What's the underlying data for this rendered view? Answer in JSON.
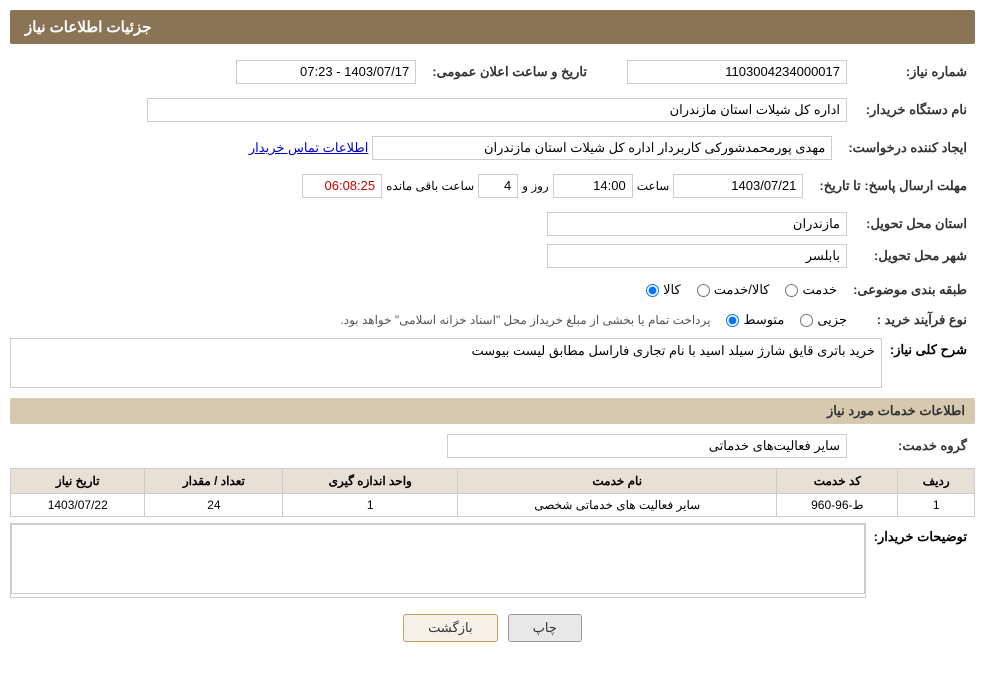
{
  "header": {
    "title": "جزئیات اطلاعات نیاز"
  },
  "fields": {
    "shomara_niaz_label": "شماره نیاز:",
    "shomara_niaz_value": "1103004234000017",
    "nam_dastgah_label": "نام دستگاه خریدار:",
    "nam_dastgah_value": "اداره کل شیلات استان مازندران",
    "ejad_konande_label": "ایجاد کننده درخواست:",
    "ejad_konande_value": "مهدی پورمحمدشورکی کاربردار اداره کل شیلات استان مازندران",
    "ejad_konande_link": "اطلاعات تماس خریدار",
    "mohlat_label": "مهلت ارسال پاسخ: تا تاریخ:",
    "mohlat_date": "1403/07/21",
    "mohlat_saat_label": "ساعت",
    "mohlat_saat": "14:00",
    "mohlat_roz_label": "روز و",
    "mohlat_roz": "4",
    "mohlat_baqi_label": "ساعت باقی مانده",
    "mohlat_baqi": "06:08:25",
    "ostan_tahvil_label": "استان محل تحویل:",
    "ostan_tahvil_value": "مازندران",
    "shahr_tahvil_label": "شهر محل تحویل:",
    "shahr_tahvil_value": "بابلسر",
    "tabaqebandi_label": "طبقه بندی موضوعی:",
    "tabaqebandi_options": [
      "خدمت",
      "کالا/خدمت",
      "کالا"
    ],
    "tabaqebandi_selected": "کالا",
    "noع_farayand_label": "نوع فرآیند خرید :",
    "noع_farayand_options": [
      "جزیی",
      "متوسط"
    ],
    "noع_farayand_selected": "متوسط",
    "noع_farayand_note": "پرداخت تمام یا بخشی از مبلغ خریداز محل \"اسناد خزانه اسلامی\" خواهد بود.",
    "sharh_label": "شرح کلی نیاز:",
    "sharh_value": "خرید باتری قایق شارژ سیلد اسید با نام تجاری فاراسل مطابق لیست بیوست",
    "khadamat_label": "اطلاعات خدمات مورد نیاز",
    "goroh_khadamat_label": "گروه خدمت:",
    "goroh_khadamat_value": "سایر فعالیت‌های خدماتی",
    "table": {
      "headers": [
        "ردیف",
        "کد خدمت",
        "نام خدمت",
        "واحد اندازه گیری",
        "تعداد / مقدار",
        "تاریخ نیاز"
      ],
      "rows": [
        {
          "radif": "1",
          "kod_khadamat": "ط-96-960",
          "nam_khadamat": "سایر فعالیت های خدماتی شخصی",
          "vahed": "1",
          "tedad": "24",
          "tarikh": "1403/07/22"
        }
      ]
    },
    "tozihat_label": "توضیحات خریدار:",
    "tozihat_value": "",
    "tarikhe_aеlan_label": "تاریخ و ساعت اعلان عمومی:",
    "tarikhe_aеlan_value": "1403/07/17 - 07:23"
  },
  "buttons": {
    "print": "چاپ",
    "back": "بازگشت"
  }
}
